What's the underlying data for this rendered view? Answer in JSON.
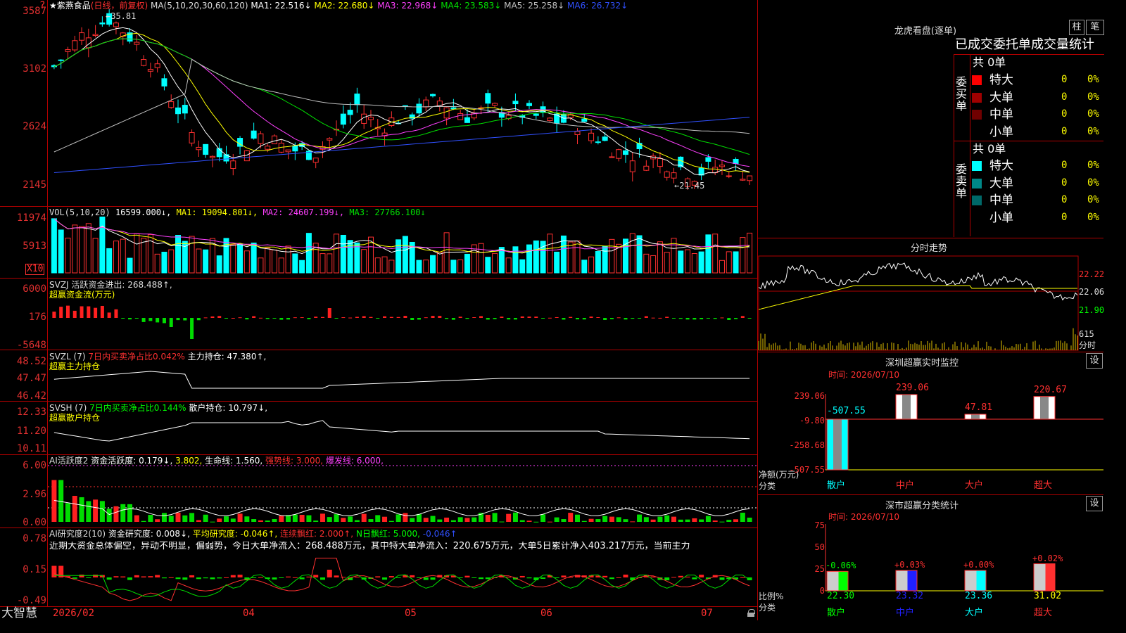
{
  "app_name": "大智慧",
  "help_icon": "?",
  "header": {
    "stock": "★紫燕食品",
    "mode": "(日线，前复权)",
    "ma_label": "MA(5,10,20,30,60,120)",
    "ma": [
      {
        "name": "MA1:",
        "value": "22.516↓",
        "color": "#ffffff"
      },
      {
        "name": "MA2:",
        "value": "22.680↓",
        "color": "#ffff00"
      },
      {
        "name": "MA3:",
        "value": "22.968↓",
        "color": "#ff40ff"
      },
      {
        "name": "MA4:",
        "value": "23.583↓",
        "color": "#00e000"
      },
      {
        "name": "MA5:",
        "value": "25.258↓",
        "color": "#c0c0c0"
      },
      {
        "name": "MA6:",
        "value": "26.732↓",
        "color": "#3050ff"
      }
    ]
  },
  "price_axis": [
    "3587",
    "3102",
    "2624",
    "2145"
  ],
  "price_annotations": {
    "high": "←35.81",
    "low": "←21.45"
  },
  "vol": {
    "label": "VOL(5,10,20)",
    "value": "16599.000↓,",
    "ma1": "MA1: 19094.801↓,",
    "ma2": "MA2: 24607.199↓,",
    "ma3": "MA3: 27766.100↓",
    "axis": [
      "11974",
      "5913"
    ],
    "unit": "X10"
  },
  "svzj": {
    "label": "SVZJ  活跃资金进出: 268.488↑,",
    "sub": "超赢资金流(万元)",
    "axis": [
      "6000",
      "176",
      "-5648"
    ]
  },
  "svzl": {
    "label": "SVZL (7)",
    "ratio": "7日内买卖净占比0.042%",
    "hold": "主力持仓: 47.380↑,",
    "sub": "超赢主力持仓",
    "axis": [
      "48.52",
      "47.47",
      "46.42"
    ]
  },
  "svsh": {
    "label": "SVSH (7)",
    "ratio": "7日内买卖净占比0.144%",
    "hold": "散户持仓: 10.797↓,",
    "sub": "超赢散户持仓",
    "axis": [
      "12.33",
      "11.20",
      "10.11"
    ]
  },
  "ai1": {
    "label": "AI活跃度2",
    "a": "资金活跃度: 0.179↓,",
    "b": "3.802,",
    "c": "生命线: 1.560,",
    "d": "强势线: 3.000,",
    "e": "爆发线: 6.000,",
    "axis": [
      "6.00",
      "2.96",
      "0.00"
    ]
  },
  "ai2": {
    "label": "AI研究度2(10)",
    "a": "资金研究度: 0.008↓,",
    "b": "平均研究度: -0.046↑,",
    "c": "连续飘红: 2.000↑,",
    "d": "N日飘红: 5.000,",
    "e": "-0.046↑",
    "comment": "近期大资金总体偏空，异动不明显，偏弱势，今日大单净流入：268.488万元，其中特大单净流入：220.675万元，大单5日累计净入403.217万元，当前主力",
    "axis": [
      "0.78",
      "0.15",
      "-0.49"
    ]
  },
  "x_axis": [
    "2026/02",
    "04",
    "05",
    "06",
    "07"
  ],
  "dragon": {
    "title": "龙虎看盘(逐单)",
    "btn_bar": "柱",
    "btn_pen": "笔",
    "subtitle": "已成交委托单成交量统计",
    "buy_label": "委买单",
    "sell_label": "委卖单",
    "buy_total": "共 0单",
    "sell_total": "共 0单",
    "rows": [
      {
        "name": "特大",
        "count": "0",
        "pct": "0%"
      },
      {
        "name": "大单",
        "count": "0",
        "pct": "0%"
      },
      {
        "name": "中单",
        "count": "0",
        "pct": "0%"
      },
      {
        "name": "小单",
        "count": "0",
        "pct": "0%"
      }
    ],
    "buy_colors": [
      "#ff0000",
      "#a00000",
      "#700000",
      "#000000"
    ],
    "sell_colors": [
      "#00ffff",
      "#008888",
      "#006868",
      "#000000"
    ]
  },
  "intraday": {
    "title": "分时走势",
    "axis": [
      "22.22",
      "22.06",
      "21.90"
    ],
    "vol": "615",
    "unit": "分时"
  },
  "monitor": {
    "title": "深圳超赢实时监控",
    "btn": "设",
    "time": "时间: 2026/07/10",
    "axis": [
      "239.06",
      "-9.80",
      "-258.68",
      "-507.55"
    ],
    "ylabel": "净额(万元)",
    "xlabel": "分类",
    "bars": [
      {
        "cat": "散户",
        "value": -507.55,
        "label": "-507.55",
        "color": "#00ffff"
      },
      {
        "cat": "中户",
        "value": 239.06,
        "label": "239.06",
        "color": "#ffffff"
      },
      {
        "cat": "大户",
        "value": 47.81,
        "label": "47.81",
        "color": "#ffffff"
      },
      {
        "cat": "超大",
        "value": 220.67,
        "label": "220.67",
        "color": "#ffffff"
      }
    ]
  },
  "classify": {
    "title": "深市超赢分类统计",
    "btn": "设",
    "time": "时间: 2026/07/10",
    "axis": [
      "75",
      "50",
      "25",
      "0"
    ],
    "ylabel": "比例%",
    "xlabel": "分类",
    "bars": [
      {
        "cat": "散户",
        "value": 22.3,
        "label": "22.30",
        "pct": "-0.06%",
        "color": "#00ff00"
      },
      {
        "cat": "中户",
        "value": 23.32,
        "label": "23.32",
        "pct": "+0.03%",
        "color": "#2020ff"
      },
      {
        "cat": "大户",
        "value": 23.36,
        "label": "23.36",
        "pct": "+0.00%",
        "color": "#00ffff"
      },
      {
        "cat": "超大",
        "value": 31.02,
        "label": "31.02",
        "pct": "+0.02%",
        "color": "#ff3030"
      }
    ]
  }
}
